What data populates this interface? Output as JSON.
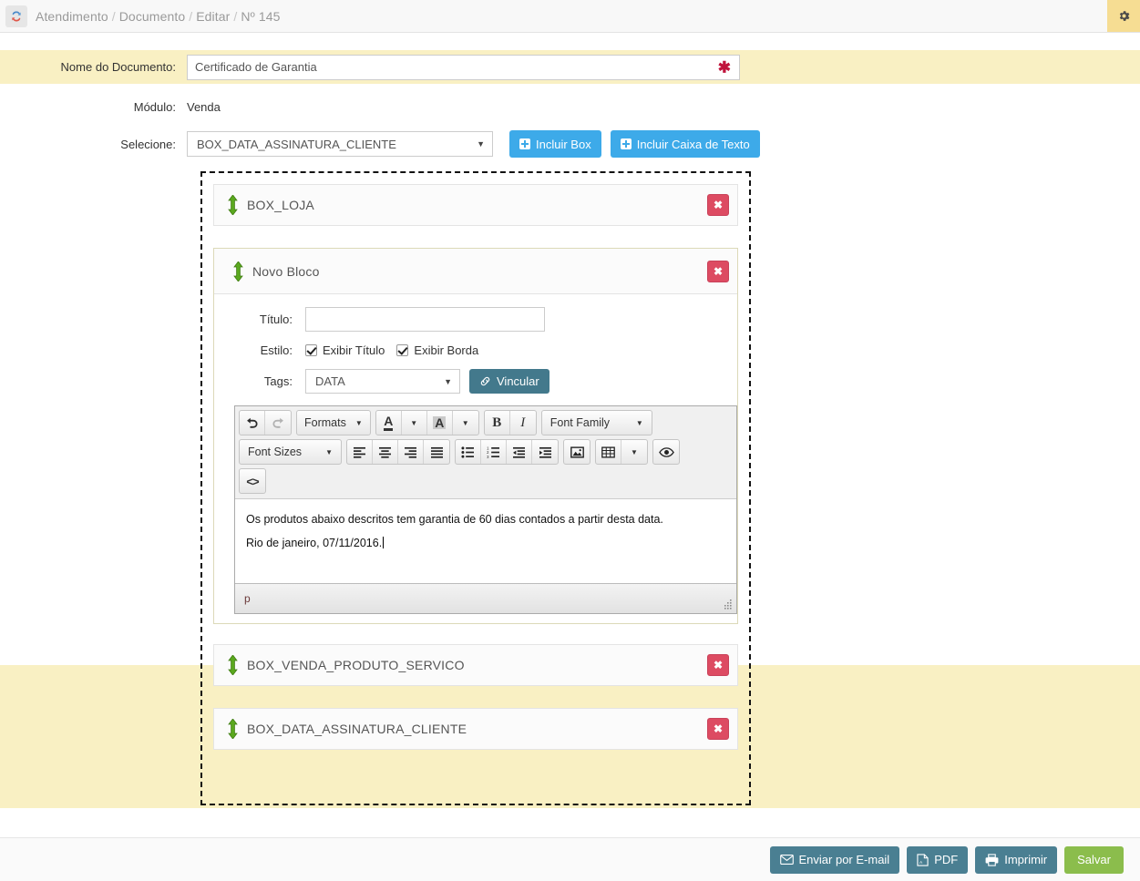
{
  "topbar": {
    "refresh_icon": "refresh-icon",
    "gear_icon": "gear-icon",
    "breadcrumb": [
      "Atendimento",
      "Documento",
      "Editar",
      "Nº 145"
    ],
    "separator": "/"
  },
  "form": {
    "nome_label": "Nome do Documento:",
    "nome_value": "Certificado de Garantia",
    "nome_required_mark": "✱",
    "modulo_label": "Módulo:",
    "modulo_value": "Venda",
    "selecione_label": "Selecione:",
    "selecione_value": "BOX_DATA_ASSINATURA_CLIENTE",
    "selecione_options": [
      "BOX_DATA_ASSINATURA_CLIENTE",
      "BOX_LOJA",
      "BOX_VENDA_PRODUTO_SERVICO"
    ],
    "btn_incluir_box": "Incluir Box",
    "btn_incluir_caixa": "Incluir Caixa de Texto"
  },
  "boxes": {
    "box_loja": {
      "label": "BOX_LOJA",
      "move_icon": "move-updown-icon",
      "delete_icon": "close-icon",
      "delete_label": "✖"
    },
    "box_venda": {
      "label": "BOX_VENDA_PRODUTO_SERVICO",
      "delete_label": "✖"
    },
    "box_data": {
      "label": "BOX_DATA_ASSINATURA_CLIENTE",
      "delete_label": "✖"
    }
  },
  "bloco": {
    "title": "Novo Bloco",
    "delete_label": "✖",
    "titulo_label": "Título:",
    "titulo_value": "",
    "estilo_label": "Estilo:",
    "chk_exibir_titulo": "Exibir Título",
    "chk_exibir_borda": "Exibir Borda",
    "tags_label": "Tags:",
    "tags_value": "DATA",
    "btn_vincular": "Vincular"
  },
  "editor": {
    "undo": "undo-icon",
    "redo": "redo-icon",
    "formats": "Formats",
    "forecolor": "A",
    "backcolor": "A",
    "bold": "B",
    "italic": "I",
    "font_family": "Font Family",
    "font_sizes": "Font Sizes",
    "align_left": "align-left-icon",
    "align_center": "align-center-icon",
    "align_right": "align-right-icon",
    "align_justify": "align-justify-icon",
    "bullist": "bullet-list-icon",
    "numlist": "numbered-list-icon",
    "outdent": "outdent-icon",
    "indent": "indent-icon",
    "image": "image-icon",
    "table": "table-icon",
    "preview": "eye-icon",
    "sourcecode": "<>",
    "content_line1": "Os produtos abaixo descritos tem garantia de 60 dias contados a partir desta data.",
    "content_line2": "Rio de janeiro, 07/11/2016.",
    "statusbar_path": "p"
  },
  "footer": {
    "btn_email": "Enviar por E-mail",
    "btn_pdf": "PDF",
    "btn_imprimir": "Imprimir",
    "btn_salvar": "Salvar",
    "email_icon": "envelope-icon",
    "pdf_icon": "pdf-file-icon",
    "print_icon": "printer-icon"
  },
  "colors": {
    "highlight_band": "#f9f0c3",
    "accent_blue": "#3daae9",
    "danger_red": "#dd4b62",
    "teal": "#43798c",
    "slate": "#4a7f92",
    "green": "#8bbd4c",
    "move_arrow_green": "#5aa81e",
    "required_red": "#c0143c"
  }
}
